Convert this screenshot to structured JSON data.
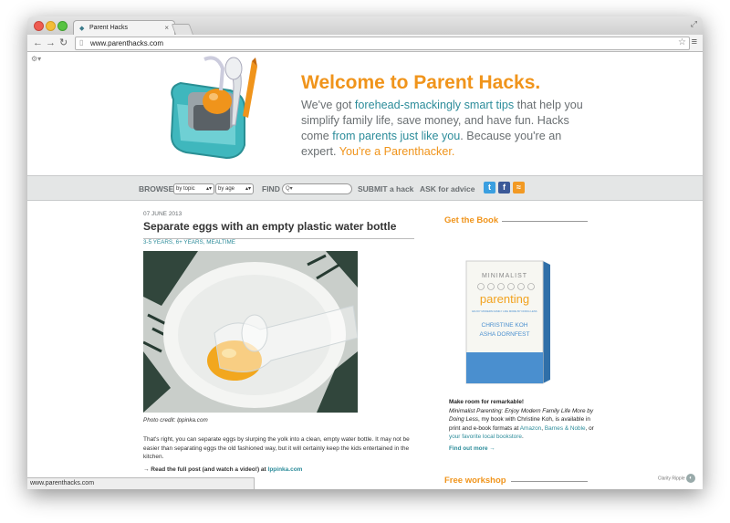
{
  "browser": {
    "tab_title": "Parent Hacks",
    "tab_close": "×",
    "url": "www.parenthacks.com",
    "status_url": "www.parenthacks.com"
  },
  "header": {
    "welcome": "Welcome to Parent Hacks.",
    "tag_1": "We've got ",
    "tag_hl1": "forehead-smackingly smart tips",
    "tag_2": " that help you simplify family life, save money, and have fun. Hacks come ",
    "tag_hl2": "from parents just like you",
    "tag_3": ". Because you're an expert. ",
    "tag_or": "You're a Parenthacker."
  },
  "navbar": {
    "browse": "BROWSE",
    "by_topic": "by topic",
    "by_age": "by age",
    "find": "FIND",
    "find_placeholder": "Q▾",
    "submit": "SUBMIT a hack",
    "ask": "ASK for advice"
  },
  "post": {
    "date": "07 JUNE 2013",
    "title": "Separate eggs with an empty plastic water bottle",
    "categories": "3-5 YEARS, 6+ YEARS, MEALTIME",
    "photo_credit": "Photo credit: lppinka.com",
    "body": "That's right, you can separate eggs by slurping the yolk into a clean, empty water bottle. It may not be easier than separating eggs the old fashioned way, but it will certainly keep the kids entertained in the kitchen.",
    "readmore_prefix": "→ Read the full post (and watch a video!) at ",
    "readmore_link": "lppinka.com"
  },
  "sidebar": {
    "get_book": "Get the Book",
    "book_title_1": "MINIMALIST",
    "book_title_2": "parenting",
    "book_sub": "ENJOY MODERN FAMILY LIFE MORE BY DOING LESS",
    "book_author_1": "CHRISTINE KOH",
    "book_author_2": "ASHA DORNFEST",
    "make_room": "Make room for remarkable!",
    "desc_italic": "Minimalist Parenting: Enjoy Modern Family Life More by Doing Less",
    "desc_1": ", my book with Christine Koh, is available in print and e-book formats at ",
    "amazon": "Amazon",
    "desc_2": ", ",
    "bn": "Barnes & Noble",
    "desc_3": ", or ",
    "local": "your favorite local bookstore",
    "desc_4": ".",
    "find_out": "Find out more →",
    "free_workshop": "Free workshop"
  },
  "badge": {
    "text": "Clarity Ripple"
  },
  "colors": {
    "accent_orange": "#f0941b",
    "accent_teal": "#2c8c9a",
    "text_gray": "#6a6f72"
  }
}
